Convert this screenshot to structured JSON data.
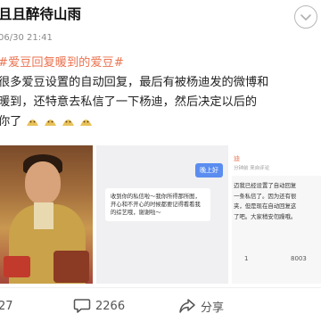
{
  "post": {
    "username": "且且醉待山雨",
    "timestamp": "06/30 21:41",
    "lines": [
      "#爱豆回复暖到的爱豆#",
      "很多爱豆设置的自动回复，最后有被杨迪发的微博和",
      "暖到，还特意去私信了一下杨迪，然后决定以后的",
      "你了"
    ]
  },
  "images": {
    "chat_right": "晚上好",
    "chat_left": "收到你的私信啦～我你所得那所图，开心和不开心的时候都要记得看看我的综艺哦，谢谢啦～",
    "side_user": "迪",
    "side_sub": "分钟前 来自评论",
    "side_lines": [
      "迈我已经设置了自动回复",
      "一条私信了。因为还有很",
      "夹，但是现在自动回复这",
      "了吧。大家稍安勿躁哦。"
    ],
    "side_stat_1": "1",
    "side_stat_2": "8003"
  },
  "actions": {
    "share_count": "27",
    "comment_count": "2266",
    "forward_label": "分享"
  },
  "colors": {
    "hashtag": "#eb7350",
    "text": "#222222"
  },
  "icons": [
    "chevron-down-icon",
    "smile-emoji-icon",
    "comment-icon",
    "forward-icon",
    "share-icon"
  ]
}
